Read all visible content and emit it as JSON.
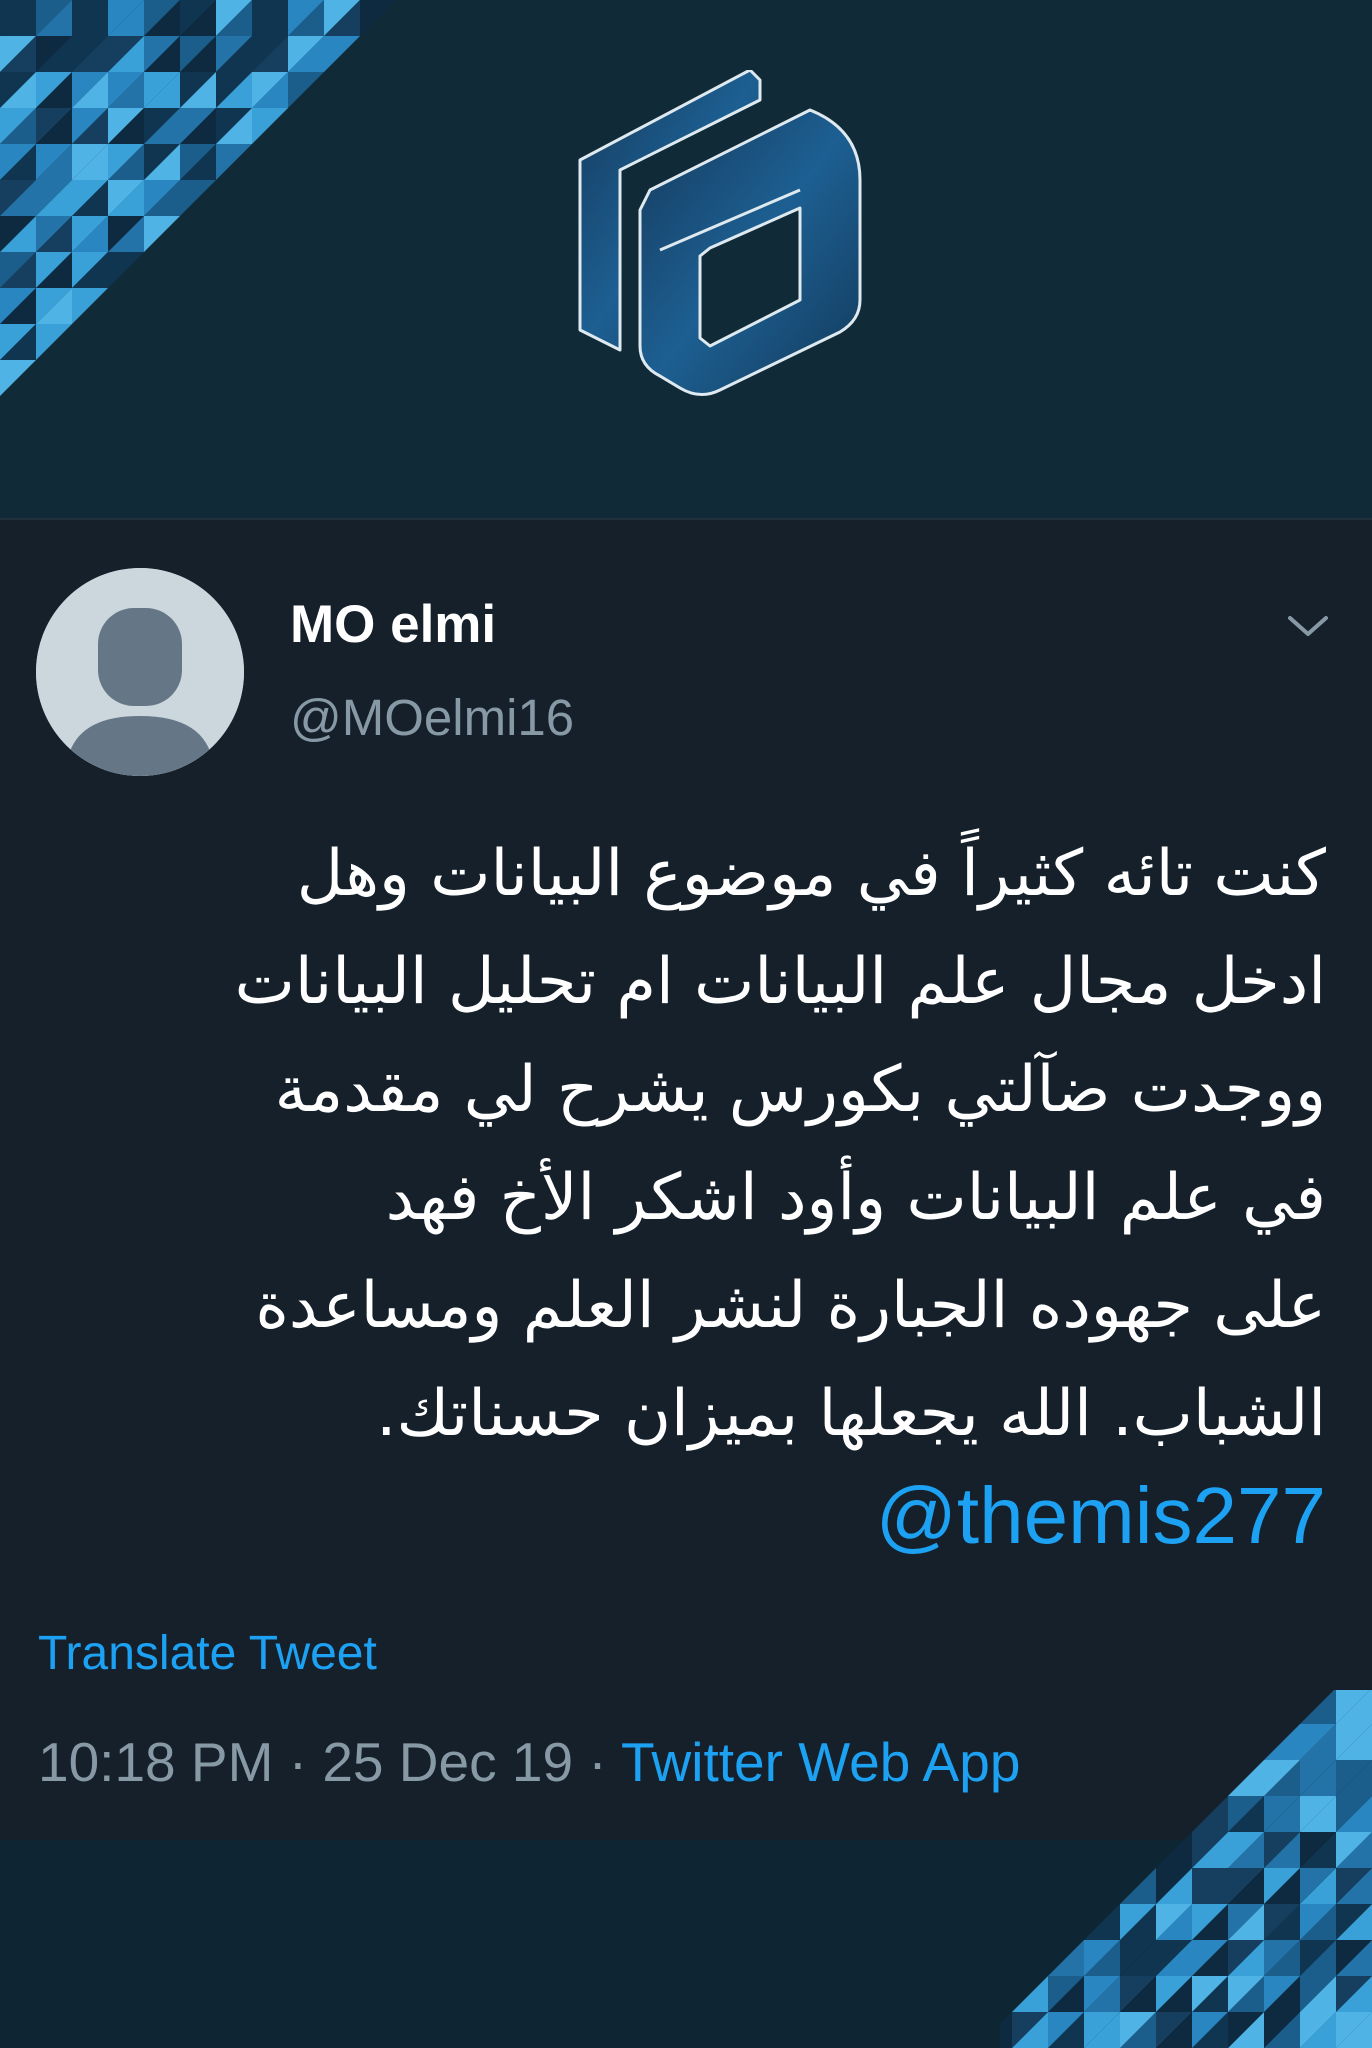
{
  "tweet": {
    "display_name": "MO elmi",
    "handle": "@MOelmi16",
    "text_lines": [
      "كنت تائه كثيراً في موضوع البيانات وهل",
      "ادخل مجال علم البيانات ام تحليل البيانات",
      "ووجدت ضآلتي بكورس يشرح لي مقدمة",
      "في علم البيانات وأود اشكر الأخ فهد",
      "على جهوده الجبارة لنشر العلم ومساعدة",
      "الشباب. الله يجعلها بميزان حسناتك."
    ],
    "mention": "@themis277",
    "translate_label": "Translate Tweet",
    "time": "10:18 PM",
    "separator": "·",
    "date": "25 Dec 19",
    "source": "Twitter Web App"
  },
  "icons": {
    "avatar": "default-profile-avatar",
    "menu": "chevron-down-icon",
    "logo": "hexagon-fa-logo"
  },
  "colors": {
    "link": "#1da1f2",
    "secondary_text": "#8899a6",
    "card_bg": "#15202b",
    "banner_bg": "#102a38"
  }
}
